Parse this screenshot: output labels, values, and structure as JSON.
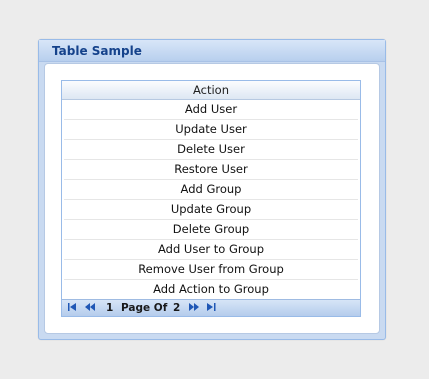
{
  "panel": {
    "title": "Table Sample"
  },
  "table": {
    "column_header": "Action",
    "rows": [
      "Add User",
      "Update User",
      "Delete User",
      "Restore User",
      "Add Group",
      "Update Group",
      "Delete Group",
      "Add User to Group",
      "Remove User from Group",
      "Add Action to Group"
    ]
  },
  "pager": {
    "current_page": "1",
    "page_of_label": "Page Of",
    "total_pages": "2",
    "icons": [
      "first-page-icon",
      "previous-page-icon",
      "next-page-icon",
      "last-page-icon"
    ]
  },
  "colors": {
    "page_background": "#ececec",
    "panel_border": "#99bbe8",
    "title_text": "#15428b",
    "pager_icon": "#1f57b5"
  }
}
